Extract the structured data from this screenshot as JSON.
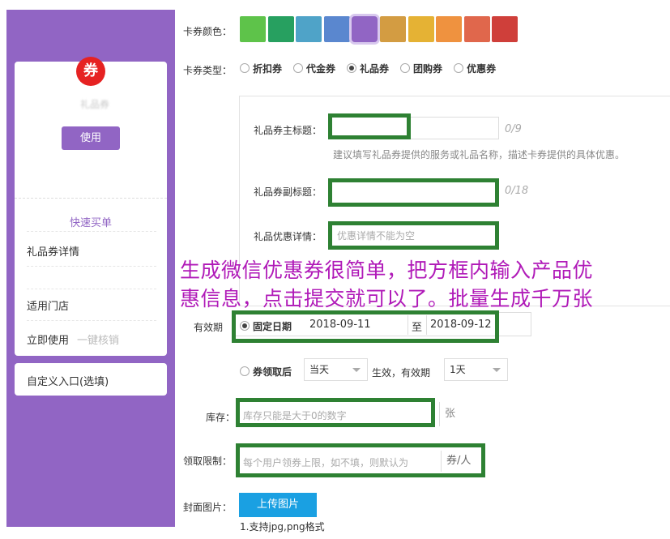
{
  "preview": {
    "logo_char": "券",
    "title_blurred": "礼品券",
    "use_button": "使用",
    "quick_buy": "快速买单",
    "menu": [
      "礼品券详情",
      "适用门店",
      "立即使用"
    ],
    "menu_sub": "一键核销",
    "custom_entry": "自定义入口(选填)"
  },
  "form": {
    "color_label": "卡券颜色：",
    "colors": [
      "#5ec34a",
      "#27a060",
      "#4fa3c8",
      "#5a87cf",
      "#9165c4",
      "#d39c42",
      "#e5b234",
      "#ef923f",
      "#e0674c",
      "#cf3f3a"
    ],
    "selected_color_index": 4,
    "type_label": "卡券类型：",
    "types": [
      "折扣券",
      "代金券",
      "礼品券",
      "团购券",
      "优惠券"
    ],
    "selected_type_index": 2,
    "main_title_label": "礼品券主标题：",
    "main_title_counter": "0/9",
    "main_title_hint": "建议填写礼品券提供的服务或礼品名称，描述卡券提供的具体优惠。",
    "sub_title_label": "礼品券副标题：",
    "sub_title_counter": "0/18",
    "detail_label": "礼品优惠详情：",
    "detail_placeholder": "优惠详情不能为空",
    "validity_label": "有效期",
    "fixed_date_label": "固定日期",
    "date_start": "2018-09-11",
    "date_to": "至",
    "date_end": "2018-09-12",
    "after_receive_label": "券领取后",
    "after_receive_select": "当天",
    "effective_text": "生效，有效期",
    "validity_select": "1天",
    "stock_label": "库存：",
    "stock_placeholder": "库存只能是大于0的数字",
    "stock_unit": "张",
    "limit_label": "领取限制：",
    "limit_placeholder": "每个用户领券上限，如不填，则默认为",
    "limit_unit": "券/人",
    "cover_label": "封面图片：",
    "upload_button": "上传图片",
    "cover_hint1": "1.支持jpg,png格式"
  },
  "overlay": {
    "line1": "生成微信优惠券很简单，把方框内输入产品优",
    "line2": "惠信息，点击提交就可以了。批量生成千万张"
  }
}
